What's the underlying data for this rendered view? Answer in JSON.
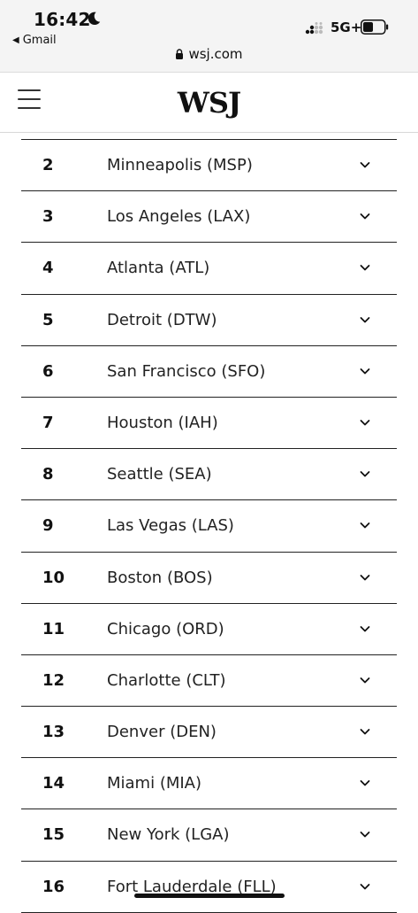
{
  "status": {
    "time": "16:42",
    "back_label": "Gmail",
    "network": "5G+",
    "url": "wsj.com"
  },
  "header": {
    "logo": "WSJ"
  },
  "rows": [
    {
      "rank": "2",
      "city": "Minneapolis (MSP)"
    },
    {
      "rank": "3",
      "city": "Los Angeles (LAX)"
    },
    {
      "rank": "4",
      "city": "Atlanta (ATL)"
    },
    {
      "rank": "5",
      "city": "Detroit (DTW)"
    },
    {
      "rank": "6",
      "city": "San Francisco (SFO)"
    },
    {
      "rank": "7",
      "city": "Houston (IAH)"
    },
    {
      "rank": "8",
      "city": "Seattle (SEA)"
    },
    {
      "rank": "9",
      "city": "Las Vegas (LAS)"
    },
    {
      "rank": "10",
      "city": "Boston (BOS)"
    },
    {
      "rank": "11",
      "city": "Chicago (ORD)"
    },
    {
      "rank": "12",
      "city": "Charlotte (CLT)"
    },
    {
      "rank": "13",
      "city": "Denver (DEN)"
    },
    {
      "rank": "14",
      "city": "Miami (MIA)"
    },
    {
      "rank": "15",
      "city": "New York (LGA)"
    },
    {
      "rank": "16",
      "city": "Fort Lauderdale (FLL)"
    }
  ]
}
